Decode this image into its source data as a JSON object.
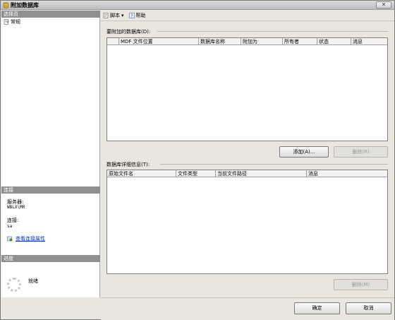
{
  "window": {
    "title": "附加数据库",
    "close_glyph": "✕"
  },
  "left": {
    "select_page_header": "选择页",
    "nav_items": [
      {
        "label": "常规",
        "icon": "page-icon"
      }
    ],
    "connection_header": "连接",
    "server_label": "服务器:",
    "server_value": "WBLX\\MR",
    "connection_label": "连接:",
    "connection_value": "sa",
    "view_connection_link": "查看连接属性",
    "progress_header": "进度",
    "progress_status": "就绪"
  },
  "toolbar": {
    "script_label": "脚本",
    "script_arrow": "▾",
    "help_label": "帮助"
  },
  "attach_section": {
    "label": "要附加的数据库(D):",
    "columns": [
      "",
      "MDF 文件位置",
      "数据库名称",
      "附加为",
      "所有者",
      "状态",
      "消息"
    ],
    "add_button": "添加(A)...",
    "remove_button": "删除(R)"
  },
  "details_section": {
    "label": "数据库详细信息(T):",
    "columns": [
      "原始文件名",
      "文件类型",
      "当前文件路径",
      "消息"
    ],
    "remove_button": "删除(M)"
  },
  "footer": {
    "ok_button": "确定",
    "cancel_button": "取消"
  }
}
